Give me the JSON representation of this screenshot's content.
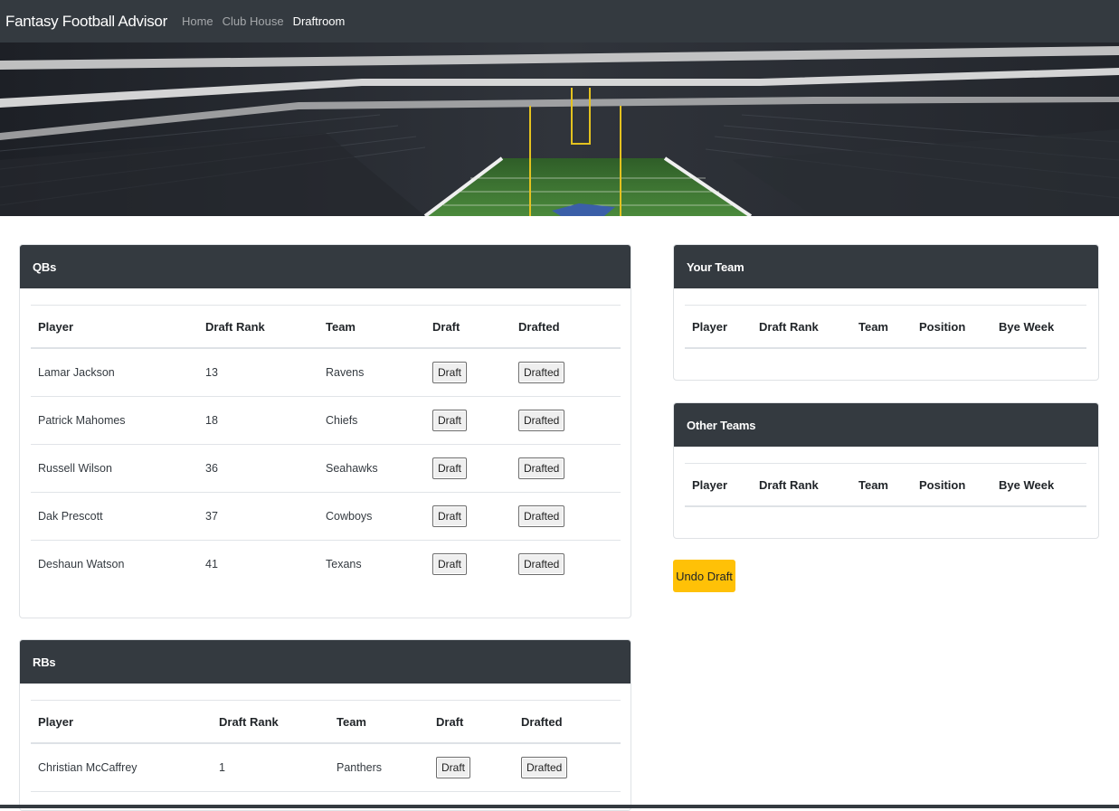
{
  "nav": {
    "brand": "Fantasy Football Advisor",
    "links": [
      "Home",
      "Club House",
      "Draftroom"
    ],
    "active_link": "Draftroom"
  },
  "qbs": {
    "title": "QBs",
    "columns": [
      "Player",
      "Draft Rank",
      "Team",
      "Draft",
      "Drafted"
    ],
    "rows": [
      {
        "player": "Lamar Jackson",
        "rank": "13",
        "team": "Ravens",
        "draft": "Draft",
        "drafted": "Drafted"
      },
      {
        "player": "Patrick Mahomes",
        "rank": "18",
        "team": "Chiefs",
        "draft": "Draft",
        "drafted": "Drafted"
      },
      {
        "player": "Russell Wilson",
        "rank": "36",
        "team": "Seahawks",
        "draft": "Draft",
        "drafted": "Drafted"
      },
      {
        "player": "Dak Prescott",
        "rank": "37",
        "team": "Cowboys",
        "draft": "Draft",
        "drafted": "Drafted"
      },
      {
        "player": "Deshaun Watson",
        "rank": "41",
        "team": "Texans",
        "draft": "Draft",
        "drafted": "Drafted"
      }
    ]
  },
  "rbs": {
    "title": "RBs",
    "columns": [
      "Player",
      "Draft Rank",
      "Team",
      "Draft",
      "Drafted"
    ],
    "rows": [
      {
        "player": "Christian McCaffrey",
        "rank": "1",
        "team": "Panthers",
        "draft": "Draft",
        "drafted": "Drafted"
      }
    ]
  },
  "your_team": {
    "title": "Your Team",
    "columns": [
      "Player",
      "Draft Rank",
      "Team",
      "Position",
      "Bye Week"
    ]
  },
  "other_teams": {
    "title": "Other Teams",
    "columns": [
      "Player",
      "Draft Rank",
      "Team",
      "Position",
      "Bye Week"
    ]
  },
  "undo_label": "Undo Draft",
  "colors": {
    "navbar": "#343a40",
    "undo_button": "#ffc107",
    "field": "#3f7a34"
  }
}
